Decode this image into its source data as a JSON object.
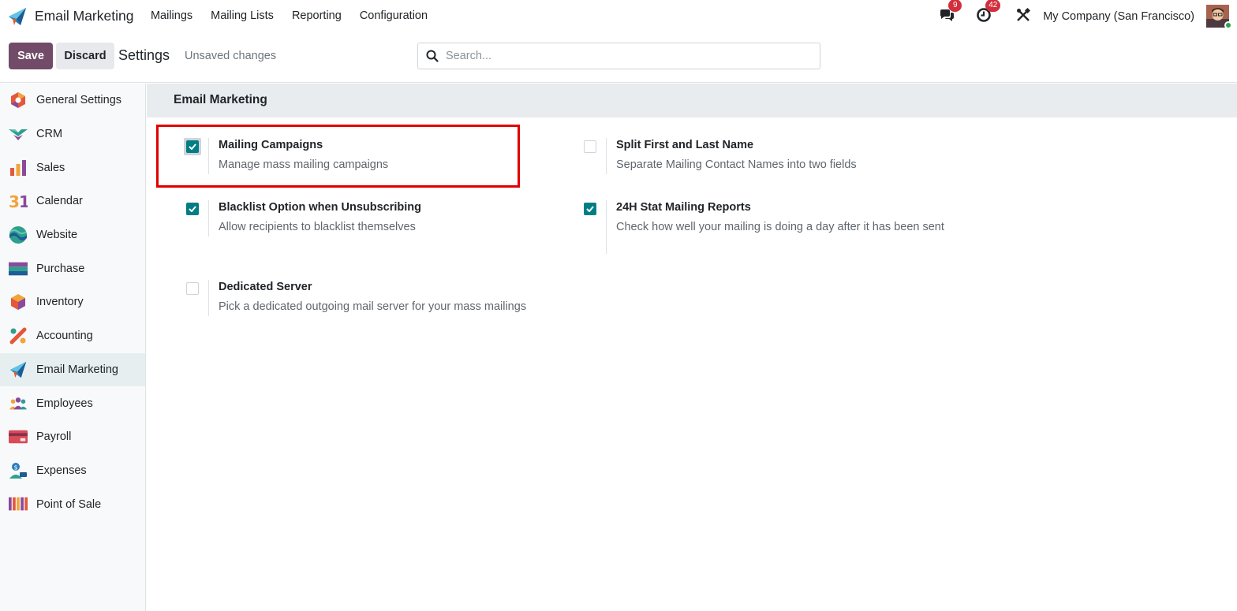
{
  "app": {
    "brand_name": "Email Marketing",
    "brand_icon": "email-marketing-paper-plane-icon"
  },
  "nav": {
    "items": [
      {
        "label": "Mailings"
      },
      {
        "label": "Mailing Lists"
      },
      {
        "label": "Reporting"
      },
      {
        "label": "Configuration"
      }
    ]
  },
  "systray": {
    "messages_badge": "9",
    "activities_badge": "42",
    "company": "My Company (San Francisco)"
  },
  "controlpanel": {
    "save_label": "Save",
    "discard_label": "Discard",
    "title": "Settings",
    "unsaved": "Unsaved changes",
    "search_placeholder": "Search..."
  },
  "sidebar": {
    "active": "Email Marketing",
    "items": [
      {
        "label": "General Settings",
        "icon": "general-settings-icon"
      },
      {
        "label": "CRM",
        "icon": "crm-icon"
      },
      {
        "label": "Sales",
        "icon": "sales-icon"
      },
      {
        "label": "Calendar",
        "icon": "calendar-icon"
      },
      {
        "label": "Website",
        "icon": "website-icon"
      },
      {
        "label": "Purchase",
        "icon": "purchase-icon"
      },
      {
        "label": "Inventory",
        "icon": "inventory-icon"
      },
      {
        "label": "Accounting",
        "icon": "accounting-icon"
      },
      {
        "label": "Email Marketing",
        "icon": "email-marketing-icon"
      },
      {
        "label": "Employees",
        "icon": "employees-icon"
      },
      {
        "label": "Payroll",
        "icon": "payroll-icon"
      },
      {
        "label": "Expenses",
        "icon": "expenses-icon"
      },
      {
        "label": "Point of Sale",
        "icon": "point-of-sale-icon"
      }
    ]
  },
  "section": {
    "title": "Email Marketing"
  },
  "settings": [
    {
      "title": "Mailing Campaigns",
      "desc": "Manage mass mailing campaigns",
      "checked": true
    },
    {
      "title": "Split First and Last Name",
      "desc": "Separate Mailing Contact Names into two fields",
      "checked": false
    },
    {
      "title": "Blacklist Option when Unsubscribing",
      "desc": "Allow recipients to blacklist themselves",
      "checked": true
    },
    {
      "title": "24H Stat Mailing Reports",
      "desc": "Check how well your mailing is doing a day after it has been sent",
      "checked": true
    },
    {
      "title": "Dedicated Server",
      "desc": "Pick a dedicated outgoing mail server for your mass mailings",
      "checked": false
    }
  ],
  "colors": {
    "primary": "#714b67",
    "checkbox_checked": "#017e84",
    "highlight": "#e00000",
    "badge": "#d22e3c"
  }
}
